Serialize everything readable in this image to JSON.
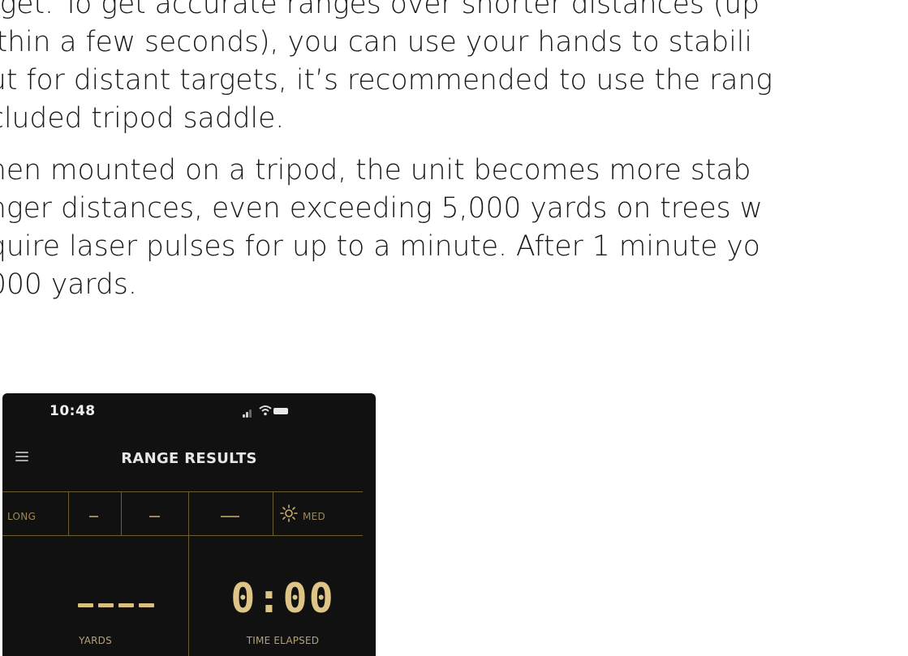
{
  "document": {
    "paragraph1": [
      "rget. To get accurate ranges over shorter distances (up",
      "ithin a few seconds), you can use your hands to stabili",
      "ut for distant targets, it’s recommended to use the rang",
      "cluded tripod saddle."
    ],
    "paragraph2": [
      "hen mounted on a tripod, the unit becomes more stab",
      "nger distances, even exceeding 5,000 yards on trees w",
      "quire laser pulses for up to a minute. After 1 minute yo",
      "000 yards."
    ]
  },
  "app": {
    "status_bar": {
      "time": "10:48",
      "icons": [
        "signal-icon",
        "wifi-icon",
        "battery-icon"
      ]
    },
    "title": "RANGE RESULTS",
    "menu_icon": "hamburger-menu-icon",
    "settings_row": {
      "mode": "LONG",
      "brightness_icon": "sun-icon",
      "brightness": "MED"
    },
    "yards_caption": "YARDS",
    "time_value": "0:00",
    "time_caption": "TIME ELAPSED",
    "colors": {
      "accent": "#c9ae6b",
      "background": "#111111",
      "divider": "#6f5d33"
    }
  }
}
